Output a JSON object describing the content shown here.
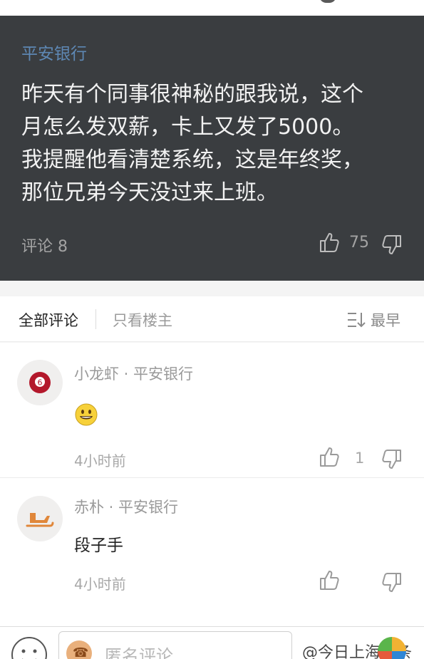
{
  "post": {
    "source": "平安银行",
    "lines": [
      "昨天有个同事很神秘的跟我说，这个",
      "月怎么发双薪，卡上又发了5000。",
      "我提醒他看清楚系统，这是年终奖，",
      "那位兄弟今天没过来上班。"
    ],
    "comment_count": "评论 8",
    "like_count": "75"
  },
  "tabs": {
    "all": "全部评论",
    "host_only": "只看楼主",
    "sort": "最早"
  },
  "comments": [
    {
      "author": "小龙虾 · 平安银行",
      "avatar_badge": "6",
      "emoji": "smiling-face",
      "time": "4小时前",
      "likes": "1"
    },
    {
      "author": "赤朴 · 平安银行",
      "text": "段子手",
      "time": "4小时前"
    }
  ],
  "bottom": {
    "placeholder": "匿名评论",
    "watermark": "@今日上海头条"
  },
  "colors": {
    "post_bg": "#3a3d40",
    "source_blue": "#5e88b4",
    "avatar_red": "#b3182b"
  }
}
